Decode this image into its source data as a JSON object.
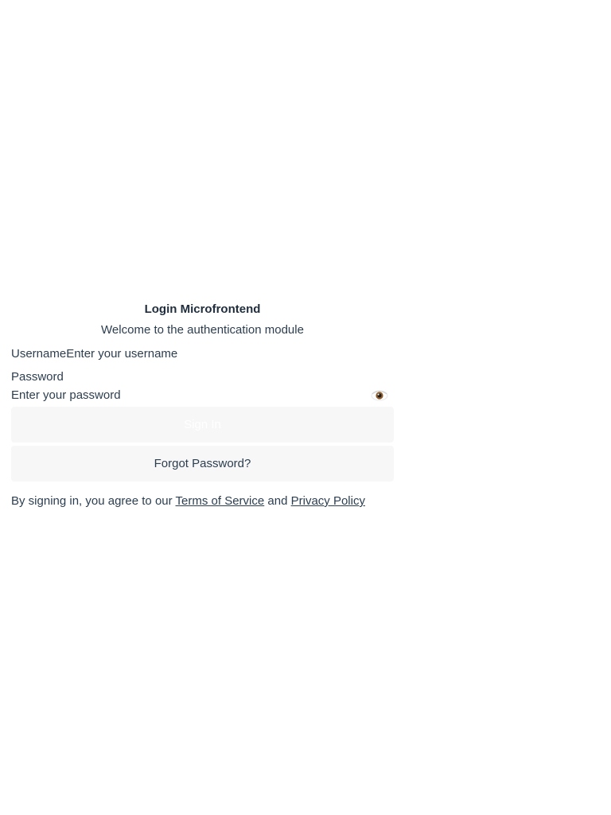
{
  "header": {
    "title": "Login Microfrontend",
    "subtitle": "Welcome to the authentication module"
  },
  "form": {
    "username_label": "Username",
    "username_placeholder": "Enter your username",
    "password_label": "Password",
    "password_placeholder": "Enter your password",
    "toggle_visibility_icon": "eye-icon",
    "signin_label": "Sign In",
    "forgot_label": "Forgot Password?"
  },
  "terms": {
    "prefix": "By signing in, you agree to our ",
    "tos_link": "Terms of Service",
    "conjunction": " and ",
    "privacy_link": "Privacy Policy"
  },
  "colors": {
    "text": "#2c3e50",
    "button_bg": "#f7f7f7",
    "signin_text": "#ffffff"
  }
}
